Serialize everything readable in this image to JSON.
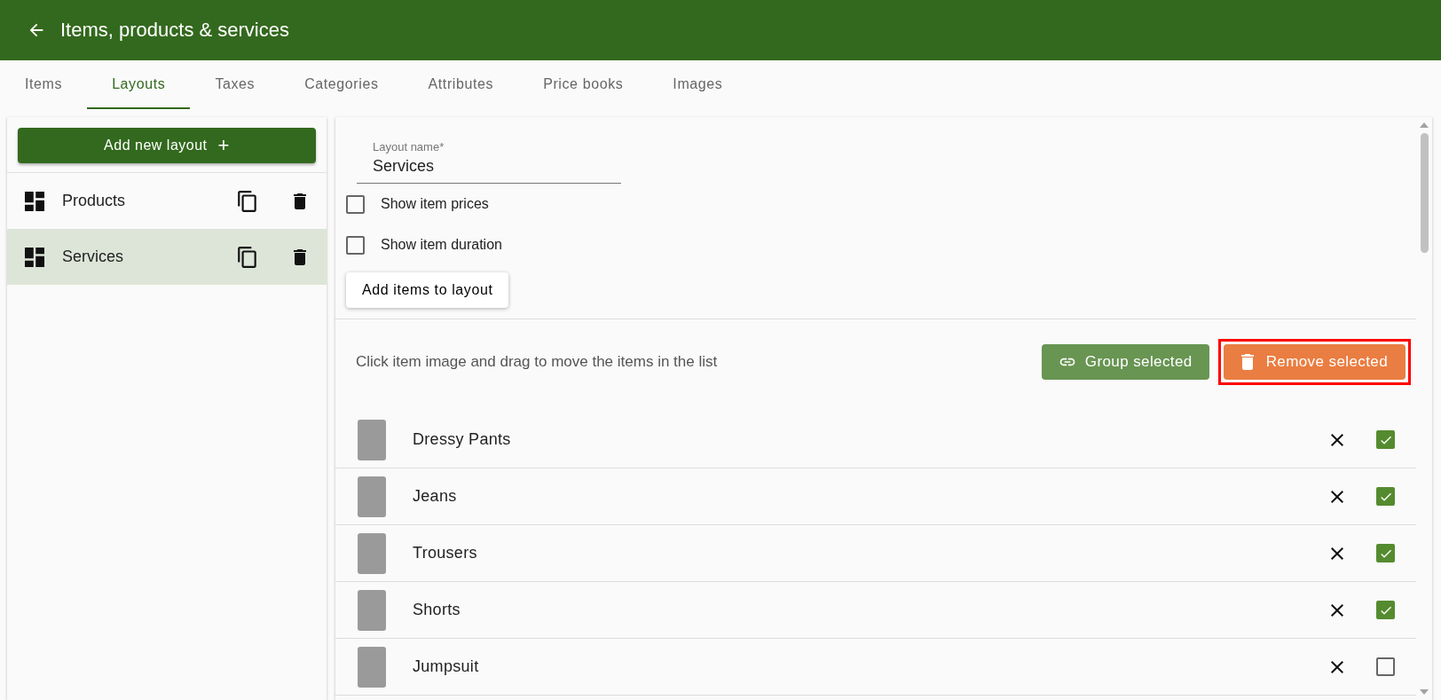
{
  "header": {
    "title": "Items, products & services"
  },
  "tabs": [
    {
      "label": "Items",
      "selected": false
    },
    {
      "label": "Layouts",
      "selected": true
    },
    {
      "label": "Taxes",
      "selected": false
    },
    {
      "label": "Categories",
      "selected": false
    },
    {
      "label": "Attributes",
      "selected": false
    },
    {
      "label": "Price books",
      "selected": false
    },
    {
      "label": "Images",
      "selected": false
    }
  ],
  "sidebar": {
    "add_button": "Add new layout",
    "add_icon": "+",
    "items": [
      {
        "label": "Products",
        "selected": false
      },
      {
        "label": "Services",
        "selected": true
      }
    ]
  },
  "form": {
    "name_field": {
      "label": "Layout name*",
      "value": "Services"
    },
    "options": [
      {
        "label": "Show item prices",
        "checked": false
      },
      {
        "label": "Show item duration",
        "checked": false
      }
    ],
    "add_items_button": "Add items to layout"
  },
  "list_toolbar": {
    "hint": "Click item image and drag to move the items in the list",
    "group_button": "Group selected",
    "remove_button": {
      "label": "Remove selected",
      "highlighted": true
    }
  },
  "items": [
    {
      "name": "Dressy Pants",
      "checked": true
    },
    {
      "name": "Jeans",
      "checked": true
    },
    {
      "name": "Trousers",
      "checked": true
    },
    {
      "name": "Shorts",
      "checked": true
    },
    {
      "name": "Jumpsuit",
      "checked": false
    }
  ]
}
